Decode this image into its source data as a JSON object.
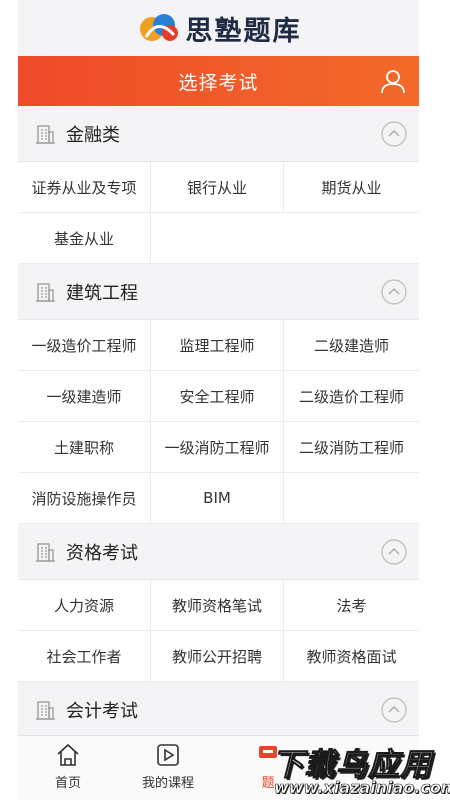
{
  "app": {
    "logo_text": "思塾题库"
  },
  "header": {
    "title": "选择考试"
  },
  "sections": [
    {
      "title": "金融类",
      "items": [
        "证券从业及专项",
        "银行从业",
        "期货从业",
        "基金从业"
      ]
    },
    {
      "title": "建筑工程",
      "items": [
        "一级造价工程师",
        "监理工程师",
        "二级建造师",
        "一级建造师",
        "安全工程师",
        "二级造价工程师",
        "土建职称",
        "一级消防工程师",
        "二级消防工程师",
        "消防设施操作员",
        "BIM"
      ]
    },
    {
      "title": "资格考试",
      "items": [
        "人力资源",
        "教师资格笔试",
        "法考",
        "社会工作者",
        "教师公开招聘",
        "教师资格面试"
      ]
    },
    {
      "title": "会计考试",
      "items": []
    }
  ],
  "tabbar": {
    "items": [
      {
        "label": "首页",
        "icon": "home-icon"
      },
      {
        "label": "我的课程",
        "icon": "play-icon"
      },
      {
        "label": "题",
        "icon": "question-bank-icon"
      }
    ]
  },
  "watermark": {
    "big": "下载鸟应用",
    "small": "www.xiazainiao.com"
  },
  "colors": {
    "accent": "#ef4a2a",
    "background": "#f4f4f6"
  }
}
